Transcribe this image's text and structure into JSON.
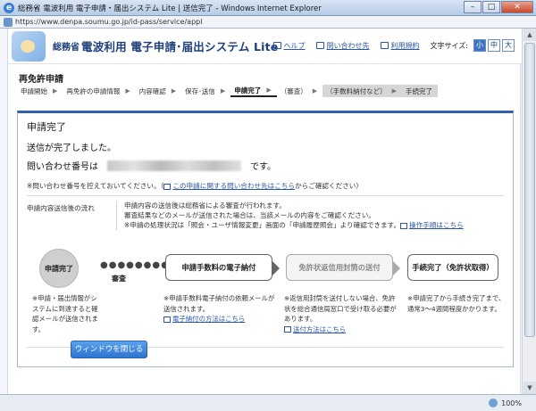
{
  "window": {
    "title": "総務省 電波利用 電子申請・届出システム Lite | 送信完了 - Windows Internet Explorer",
    "url": "https://www.denpa.soumu.go.jp/id-pass/service/appl",
    "buttons": {
      "minimize": "–",
      "maximize": "□",
      "close": "✕"
    }
  },
  "header": {
    "ministry": "総務省",
    "system_title": "電波利用 電子申請･届出システム Lite",
    "links": [
      {
        "label": "ヘルプ"
      },
      {
        "label": "問い合わせ先"
      },
      {
        "label": "利用規約"
      }
    ],
    "font_size_label": "文字サイズ:",
    "font_sizes": [
      "小",
      "中",
      "大"
    ],
    "font_size_selected": "小"
  },
  "section_title": "再免許申請",
  "steps": [
    {
      "label": "申請開始"
    },
    {
      "label": "再免許の申請情報"
    },
    {
      "label": "内容確認"
    },
    {
      "label": "保存･送信"
    },
    {
      "label": "申請完了"
    },
    {
      "label": "（審査）"
    },
    {
      "label": "（手数料納付など）"
    },
    {
      "label": "手続完了"
    }
  ],
  "panel": {
    "title": "申請完了",
    "sent_message": "送信が完了しました。",
    "inquiry_prefix": "問い合わせ番号は",
    "inquiry_suffix": "です。",
    "note_prefix": "※問い合わせ番号を控えておいてください。（",
    "note_link": "この申請に関する問い合わせ先はこちら",
    "note_suffix": "からご確認ください）",
    "flow_label": "申請内容送信後の流れ",
    "flow_desc_1": "申請内容の送信後は総務省による審査が行われます。",
    "flow_desc_2": "審査結果などのメールが送信された場合は、当該メールの内容をご確認ください。",
    "flow_desc_3": "※申請の処理状況は「照会・ユーザ情報変更」画面の「申請履歴照会」より確認できます。",
    "flow_desc_link": "操作手順はこちら"
  },
  "flow": {
    "circle": "申請完了",
    "dots": "●●●●●●●●",
    "review": "審査",
    "box1": "申請手数料の電子納付",
    "box2": "免許状返信用封筒の送付",
    "box3": "手続完了（免許状取得）",
    "desc0": "※申請・届出情報がシステムに到達すると確認メールが送信されます。",
    "desc1": "※申請手数料電子納付の依頼メールが送信されます。",
    "desc1_link": "電子納付の方法はこちら",
    "desc2": "※返信用封筒を送付しない場合、免許状を総合通信局窓口で受け取る必要があります。",
    "desc2_link": "送付方法はこちら",
    "desc3": "※申請完了から手続き完了まで、通常3〜4週間程度かかります。"
  },
  "close_button": "ウィンドウを閉じる",
  "status": {
    "zoom": "100%"
  },
  "colors": {
    "accent": "#2f5fae",
    "button": "#3e85dc",
    "link": "#2a55a8"
  }
}
